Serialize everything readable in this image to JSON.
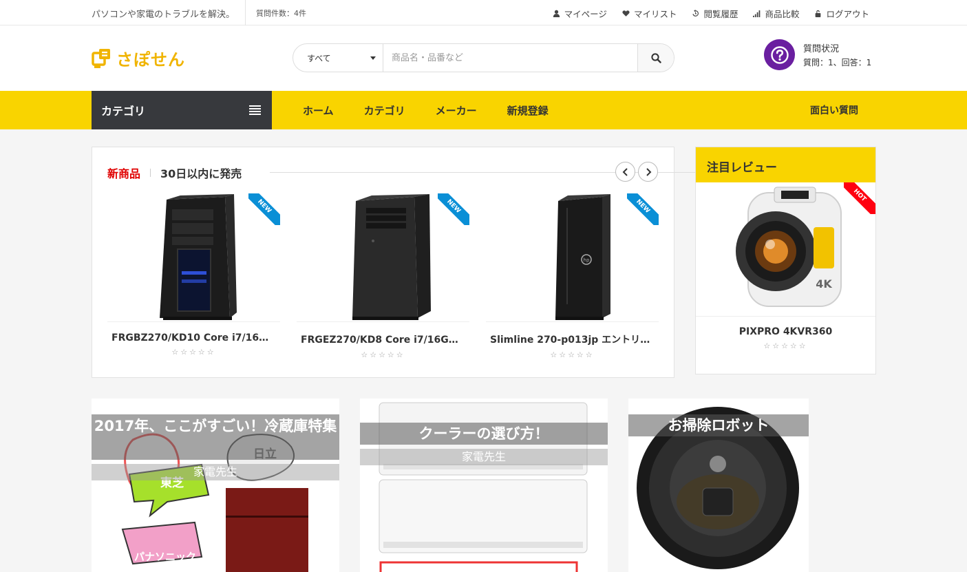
{
  "topbar": {
    "tagline": "パソコンや家電のトラブルを解決。",
    "question_count": "質問件数：4件",
    "links": [
      "マイページ",
      "マイリスト",
      "閲覧履歴",
      "商品比較",
      "ログアウト"
    ]
  },
  "header": {
    "logo_text": "さぽせん",
    "search": {
      "category": "すべて",
      "placeholder": "商品名・品番など"
    },
    "question_status": {
      "title": "質問状況",
      "detail": "質問：1、回答：1"
    }
  },
  "nav": {
    "category_label": "カテゴリ",
    "items": [
      "ホーム",
      "カテゴリ",
      "メーカー",
      "新規登録"
    ],
    "right_item": "面白い質問"
  },
  "new_products": {
    "title": "新商品",
    "subtitle": "30日以内に発売",
    "ribbon": "NEW",
    "items": [
      {
        "name": "FRGBZ270/KD10 Core i7/16GB…",
        "rating": "☆☆☆☆☆"
      },
      {
        "name": "FRGEZ270/KD8 Core i7/16GBメ…",
        "rating": "☆☆☆☆☆"
      },
      {
        "name": "Slimline 270-p013jp エントリー…",
        "rating": "☆☆☆☆☆"
      }
    ]
  },
  "review": {
    "title": "注目レビュー",
    "ribbon": "HOT",
    "product_name": "PIXPRO 4KVR360",
    "rating": "☆☆☆☆☆"
  },
  "features": [
    {
      "title": "2017年、ここがすごい！冷蔵庫特集",
      "author": "家電先生",
      "image_texts": [
        "日立",
        "東芝",
        "パナソニック"
      ]
    },
    {
      "title": "クーラーの選び方！",
      "author": "家電先生"
    },
    {
      "title": "お掃除ロボット"
    }
  ],
  "colors": {
    "accent_yellow": "#f9d400",
    "dark_panel": "#37393d",
    "new_ribbon": "#0a8fd6",
    "hot_ribbon": "#ff0010",
    "highlight_red": "#e00000",
    "question_icon": "#6a1fa0"
  }
}
